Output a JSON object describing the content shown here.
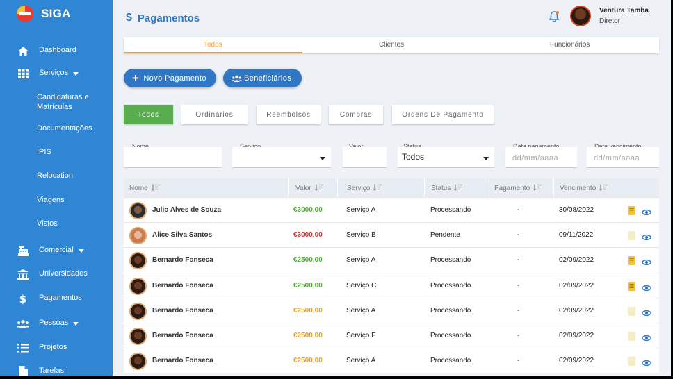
{
  "brand": {
    "name": "SIGA"
  },
  "sidebar": {
    "items": [
      {
        "label": "Dashboard",
        "icon": "home-icon"
      },
      {
        "label": "Serviços",
        "icon": "grid-icon",
        "caret": true
      },
      {
        "label": "Candidaturas e Matrículas",
        "sub": true
      },
      {
        "label": "Documentações",
        "sub": true
      },
      {
        "label": "IPIS",
        "sub": true
      },
      {
        "label": "Relocation",
        "sub": true
      },
      {
        "label": "Viagens",
        "sub": true
      },
      {
        "label": "Vistos",
        "sub": true
      },
      {
        "label": "Comercial",
        "icon": "cash-register-icon",
        "caret": true
      },
      {
        "label": "Universidades",
        "icon": "university-icon"
      },
      {
        "label": "Pagamentos",
        "icon": "dollar-icon"
      },
      {
        "label": "Pessoas",
        "icon": "users-icon",
        "caret": true
      },
      {
        "label": "Projetos",
        "icon": "list-icon"
      },
      {
        "label": "Tarefas",
        "icon": "file-icon"
      }
    ]
  },
  "header": {
    "title": "Pagamentos",
    "user_name": "Ventura Tamba",
    "user_role": "Diretor"
  },
  "top_tabs": [
    "Todos",
    "Clientes",
    "Funcionários"
  ],
  "actions": {
    "new_payment": "Novo Pagamento",
    "beneficiaries": "Beneficiários"
  },
  "filter_tabs": [
    "Todos",
    "Ordinários",
    "Reembolsos",
    "Compras",
    "Ordens De Pagamento"
  ],
  "filters": {
    "nome_label": "Nome",
    "servico_label": "Serviço",
    "valor_label": "Valor",
    "status_label": "Status",
    "status_value": "Todos",
    "data_pagamento_label": "Data pagamento",
    "data_pagamento_placeholder": "dd/mm/aaaa",
    "data_vencimento_label": "Data vencimento",
    "data_vencimento_placeholder": "dd/mm/aaaa"
  },
  "table": {
    "headers": [
      "Nome",
      "Valor",
      "Serviço",
      "Status",
      "Pagamento",
      "Vencimento"
    ],
    "rows": [
      {
        "nome": "Julio Alves de Souza",
        "valor": "€3000,00",
        "servico": "Serviço A",
        "status": "Processando",
        "pagamento": "-",
        "vencimento": "30/08/2022",
        "valor_color": "#4caf30",
        "doc_active": true
      },
      {
        "nome": "Alice Silva Santos",
        "valor": "€3000,00",
        "servico": "Serviço B",
        "status": "Pendente",
        "pagamento": "-",
        "vencimento": "09/11/2022",
        "valor_color": "#d32f2f",
        "doc_active": false
      },
      {
        "nome": "Bernardo Fonseca",
        "valor": "€2500,00",
        "servico": "Serviço A",
        "status": "Processando",
        "pagamento": "-",
        "vencimento": "02/09/2022",
        "valor_color": "#4caf30",
        "doc_active": true
      },
      {
        "nome": "Bernardo Fonseca",
        "valor": "€2500,00",
        "servico": "Serviço C",
        "status": "Processando",
        "pagamento": "-",
        "vencimento": "02/09/2022",
        "valor_color": "#4caf30",
        "doc_active": true
      },
      {
        "nome": "Bernardo Fonseca",
        "valor": "€2500,00",
        "servico": "Serviço A",
        "status": "Processando",
        "pagamento": "-",
        "vencimento": "02/09/2022",
        "valor_color": "#f0a020",
        "doc_active": false
      },
      {
        "nome": "Bernardo Fonseca",
        "valor": "€2500,00",
        "servico": "Serviço F",
        "status": "Processando",
        "pagamento": "-",
        "vencimento": "02/09/2022",
        "valor_color": "#f0a020",
        "doc_active": false
      },
      {
        "nome": "Bernardo Fonseca",
        "valor": "€2500,00",
        "servico": "Serviço A",
        "status": "Processando",
        "pagamento": "-",
        "vencimento": "02/09/2022",
        "valor_color": "#f0a020",
        "doc_active": false
      }
    ]
  },
  "colors": {
    "sidebar": "#2f86d4",
    "primary": "#2f76c4",
    "accent_tab": "#f0a13a",
    "active_filter": "#5aad4f"
  }
}
